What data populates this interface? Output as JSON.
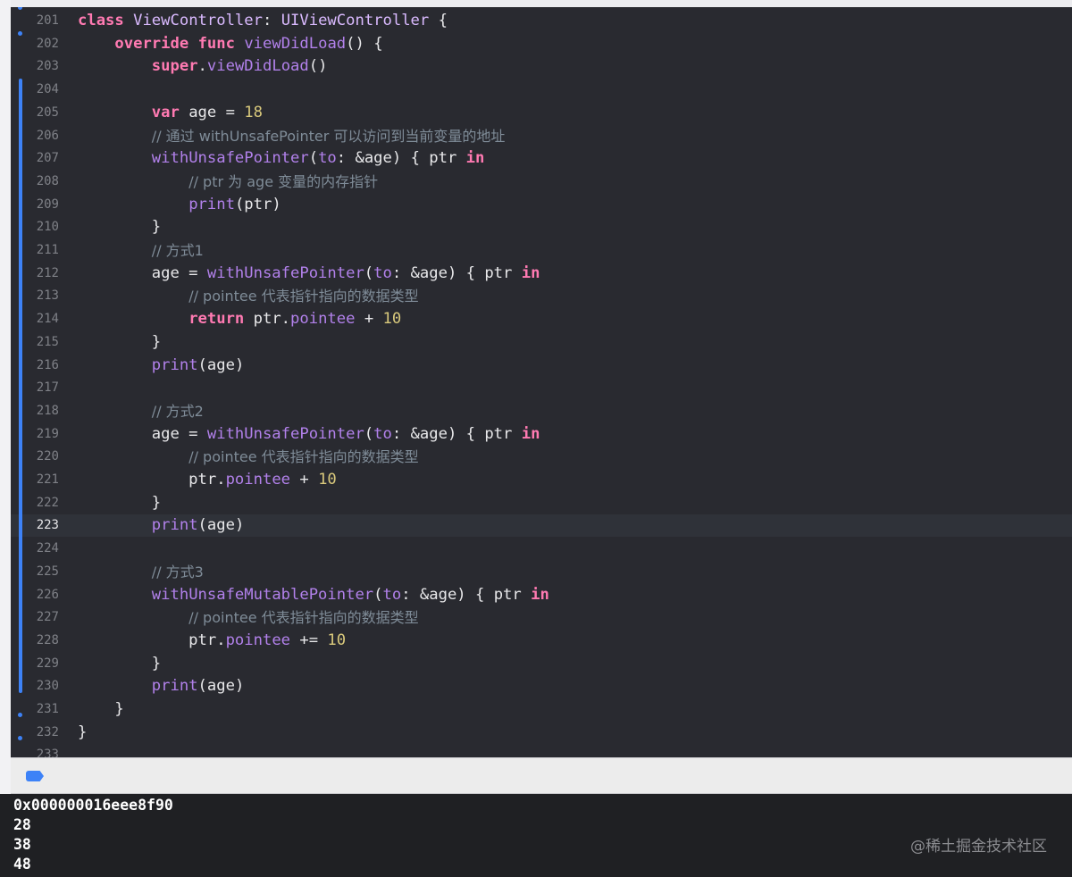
{
  "editor": {
    "current_line": "223",
    "lines": [
      {
        "num": "201",
        "tokens": [
          {
            "t": "class",
            "c": "kw"
          },
          {
            "t": " "
          },
          {
            "t": "ViewController",
            "c": "cls"
          },
          {
            "t": ": "
          },
          {
            "t": "UIViewController",
            "c": "cls"
          },
          {
            "t": " {"
          }
        ]
      },
      {
        "num": "202",
        "tokens": [
          {
            "t": "    "
          },
          {
            "t": "override",
            "c": "kw"
          },
          {
            "t": " "
          },
          {
            "t": "func",
            "c": "kw"
          },
          {
            "t": " "
          },
          {
            "t": "viewDidLoad",
            "c": "fn"
          },
          {
            "t": "() {"
          }
        ]
      },
      {
        "num": "203",
        "tokens": [
          {
            "t": "        "
          },
          {
            "t": "super",
            "c": "kw"
          },
          {
            "t": "."
          },
          {
            "t": "viewDidLoad",
            "c": "fn"
          },
          {
            "t": "()"
          }
        ]
      },
      {
        "num": "204",
        "tokens": []
      },
      {
        "num": "205",
        "tokens": [
          {
            "t": "        "
          },
          {
            "t": "var",
            "c": "kw"
          },
          {
            "t": " age = "
          },
          {
            "t": "18",
            "c": "num"
          }
        ]
      },
      {
        "num": "206",
        "tokens": [
          {
            "t": "        "
          },
          {
            "t": "// 通过 withUnsafePointer 可以访问到当前变量的地址",
            "c": "cmt"
          }
        ]
      },
      {
        "num": "207",
        "tokens": [
          {
            "t": "        "
          },
          {
            "t": "withUnsafePointer",
            "c": "fn"
          },
          {
            "t": "("
          },
          {
            "t": "to",
            "c": "fn"
          },
          {
            "t": ": &age) { ptr "
          },
          {
            "t": "in",
            "c": "kw"
          }
        ]
      },
      {
        "num": "208",
        "tokens": [
          {
            "t": "            "
          },
          {
            "t": "// ptr 为 age 变量的内存指针",
            "c": "cmt"
          }
        ]
      },
      {
        "num": "209",
        "tokens": [
          {
            "t": "            "
          },
          {
            "t": "print",
            "c": "fn"
          },
          {
            "t": "(ptr)"
          }
        ]
      },
      {
        "num": "210",
        "tokens": [
          {
            "t": "        }"
          }
        ]
      },
      {
        "num": "211",
        "tokens": [
          {
            "t": "        "
          },
          {
            "t": "// 方式1",
            "c": "cmt"
          }
        ]
      },
      {
        "num": "212",
        "tokens": [
          {
            "t": "        age = "
          },
          {
            "t": "withUnsafePointer",
            "c": "fn"
          },
          {
            "t": "("
          },
          {
            "t": "to",
            "c": "fn"
          },
          {
            "t": ": &age) { ptr "
          },
          {
            "t": "in",
            "c": "kw"
          }
        ]
      },
      {
        "num": "213",
        "tokens": [
          {
            "t": "            "
          },
          {
            "t": "// pointee 代表指针指向的数据类型",
            "c": "cmt"
          }
        ]
      },
      {
        "num": "214",
        "tokens": [
          {
            "t": "            "
          },
          {
            "t": "return",
            "c": "kw"
          },
          {
            "t": " ptr."
          },
          {
            "t": "pointee",
            "c": "fn"
          },
          {
            "t": " + "
          },
          {
            "t": "10",
            "c": "num"
          }
        ]
      },
      {
        "num": "215",
        "tokens": [
          {
            "t": "        }"
          }
        ]
      },
      {
        "num": "216",
        "tokens": [
          {
            "t": "        "
          },
          {
            "t": "print",
            "c": "fn"
          },
          {
            "t": "(age)"
          }
        ]
      },
      {
        "num": "217",
        "tokens": []
      },
      {
        "num": "218",
        "tokens": [
          {
            "t": "        "
          },
          {
            "t": "// 方式2",
            "c": "cmt"
          }
        ]
      },
      {
        "num": "219",
        "tokens": [
          {
            "t": "        age = "
          },
          {
            "t": "withUnsafePointer",
            "c": "fn"
          },
          {
            "t": "("
          },
          {
            "t": "to",
            "c": "fn"
          },
          {
            "t": ": &age) { ptr "
          },
          {
            "t": "in",
            "c": "kw"
          }
        ]
      },
      {
        "num": "220",
        "tokens": [
          {
            "t": "            "
          },
          {
            "t": "// pointee 代表指针指向的数据类型",
            "c": "cmt"
          }
        ]
      },
      {
        "num": "221",
        "tokens": [
          {
            "t": "            ptr."
          },
          {
            "t": "pointee",
            "c": "fn"
          },
          {
            "t": " + "
          },
          {
            "t": "10",
            "c": "num"
          }
        ]
      },
      {
        "num": "222",
        "tokens": [
          {
            "t": "        }"
          }
        ]
      },
      {
        "num": "223",
        "tokens": [
          {
            "t": "        "
          },
          {
            "t": "print",
            "c": "fn"
          },
          {
            "t": "(age)"
          }
        ]
      },
      {
        "num": "224",
        "tokens": []
      },
      {
        "num": "225",
        "tokens": [
          {
            "t": "        "
          },
          {
            "t": "// 方式3",
            "c": "cmt"
          }
        ]
      },
      {
        "num": "226",
        "tokens": [
          {
            "t": "        "
          },
          {
            "t": "withUnsafeMutablePointer",
            "c": "fn"
          },
          {
            "t": "("
          },
          {
            "t": "to",
            "c": "fn"
          },
          {
            "t": ": &age) { ptr "
          },
          {
            "t": "in",
            "c": "kw"
          }
        ]
      },
      {
        "num": "227",
        "tokens": [
          {
            "t": "            "
          },
          {
            "t": "// pointee 代表指针指向的数据类型",
            "c": "cmt"
          }
        ]
      },
      {
        "num": "228",
        "tokens": [
          {
            "t": "            ptr."
          },
          {
            "t": "pointee",
            "c": "fn"
          },
          {
            "t": " += "
          },
          {
            "t": "10",
            "c": "num"
          }
        ]
      },
      {
        "num": "229",
        "tokens": [
          {
            "t": "        }"
          }
        ]
      },
      {
        "num": "230",
        "tokens": [
          {
            "t": "        "
          },
          {
            "t": "print",
            "c": "fn"
          },
          {
            "t": "(age)"
          }
        ]
      },
      {
        "num": "231",
        "tokens": [
          {
            "t": "    }"
          }
        ]
      },
      {
        "num": "232",
        "tokens": [
          {
            "t": "}"
          }
        ]
      },
      {
        "num": "233",
        "tokens": []
      }
    ]
  },
  "colors": {
    "editor_background": "#292a30",
    "keyword": "#ff7ab2",
    "type": "#dabaff",
    "function": "#b281eb",
    "number": "#d9c97c",
    "comment": "#7f8c98",
    "change_indicator": "#3d82f7"
  },
  "debug_bar": {
    "toggle_icon": "debug-area-toggle-icon"
  },
  "console": {
    "lines": [
      "0x000000016eee8f90",
      "28",
      "38",
      "48"
    ],
    "watermark": "@稀土掘金技术社区"
  }
}
